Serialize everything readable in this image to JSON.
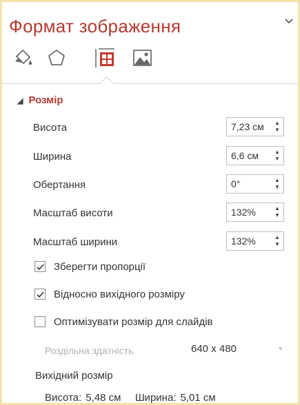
{
  "pane": {
    "title": "Формат зображення",
    "menu_icon": "chevron-down-icon"
  },
  "tabs": [
    {
      "name": "fill-and-line",
      "icon": "paint-bucket-icon"
    },
    {
      "name": "effects",
      "icon": "pentagon-icon"
    },
    {
      "name": "size-and-properties",
      "icon": "size-properties-icon",
      "selected": true
    },
    {
      "name": "picture",
      "icon": "picture-icon"
    }
  ],
  "section": {
    "label": "Розмір",
    "expanded_icon": "triangle-expanded-icon"
  },
  "fields": {
    "height": {
      "label": "Висота",
      "value": "7,23 см"
    },
    "width": {
      "label": "Ширина",
      "value": "6,6 см"
    },
    "rotation": {
      "label": "Обертання",
      "value": "0°"
    },
    "scale_height": {
      "label": "Масштаб висоти",
      "value": "132%"
    },
    "scale_width": {
      "label": "Масштаб ширини",
      "value": "132%"
    }
  },
  "checkboxes": {
    "lock_aspect": {
      "label": "Зберегти пропорції",
      "checked": true
    },
    "relative_original": {
      "label": "Відносно вихідного розміру",
      "checked": true
    },
    "best_scale": {
      "label": "Оптимізувати розмір для слайдів",
      "checked": false
    }
  },
  "resolution": {
    "label": "Роздільна здатність",
    "value": "640 x 480",
    "disabled": true
  },
  "original_size": {
    "title": "Вихідний розмір",
    "height_label": "Висота:",
    "height_value": "5,48 см",
    "width_label": "Ширина:",
    "width_value": "5,01 см"
  },
  "colors": {
    "accent": "#b23a2e",
    "frame": "#f3e3a8",
    "size_tab": "#c0392b"
  }
}
